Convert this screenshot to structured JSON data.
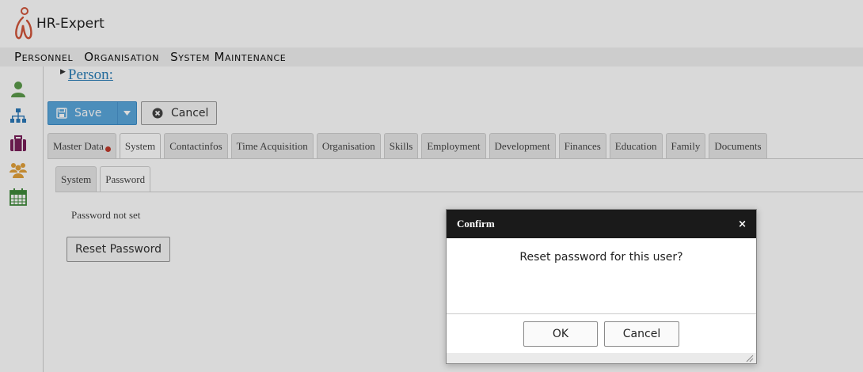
{
  "header": {
    "app_title": "HR-Expert",
    "logo_icon": "hr-expert-logo"
  },
  "menu": [
    "Personnel",
    "Organisation",
    "System Maintenance"
  ],
  "sidebar": {
    "items": [
      {
        "icon": "person-icon",
        "color": "#5b9a4a"
      },
      {
        "icon": "org-chart-icon",
        "color": "#2b78b8"
      },
      {
        "icon": "briefcase-icon",
        "color": "#7a1f5a"
      },
      {
        "icon": "group-icon",
        "color": "#e3a23a"
      },
      {
        "icon": "calendar-icon",
        "color": "#3f8a3a"
      }
    ]
  },
  "breadcrumb": {
    "label": "Person:"
  },
  "toolbar": {
    "save_label": "Save",
    "cancel_label": "Cancel"
  },
  "tabs": [
    {
      "label": "Master Data",
      "badge": true
    },
    {
      "label": "System",
      "active": true
    },
    {
      "label": "Contactinfos"
    },
    {
      "label": "Time Acquisition"
    },
    {
      "label": "Organisation"
    },
    {
      "label": "Skills"
    },
    {
      "label": "Employment"
    },
    {
      "label": "Development"
    },
    {
      "label": "Finances"
    },
    {
      "label": "Education"
    },
    {
      "label": "Family"
    },
    {
      "label": "Documents"
    }
  ],
  "subtabs": [
    {
      "label": "System"
    },
    {
      "label": "Password",
      "active": true
    }
  ],
  "password_panel": {
    "status": "Password not set",
    "reset_label": "Reset Password"
  },
  "dialog": {
    "title": "Confirm",
    "close_glyph": "×",
    "message": "Reset password for this user?",
    "ok_label": "OK",
    "cancel_label": "Cancel"
  },
  "colors": {
    "accent": "#5aa7dc",
    "link": "#2c7fb8",
    "dialog_title_bg": "#1a1a1a",
    "badge": "#c0392b"
  }
}
